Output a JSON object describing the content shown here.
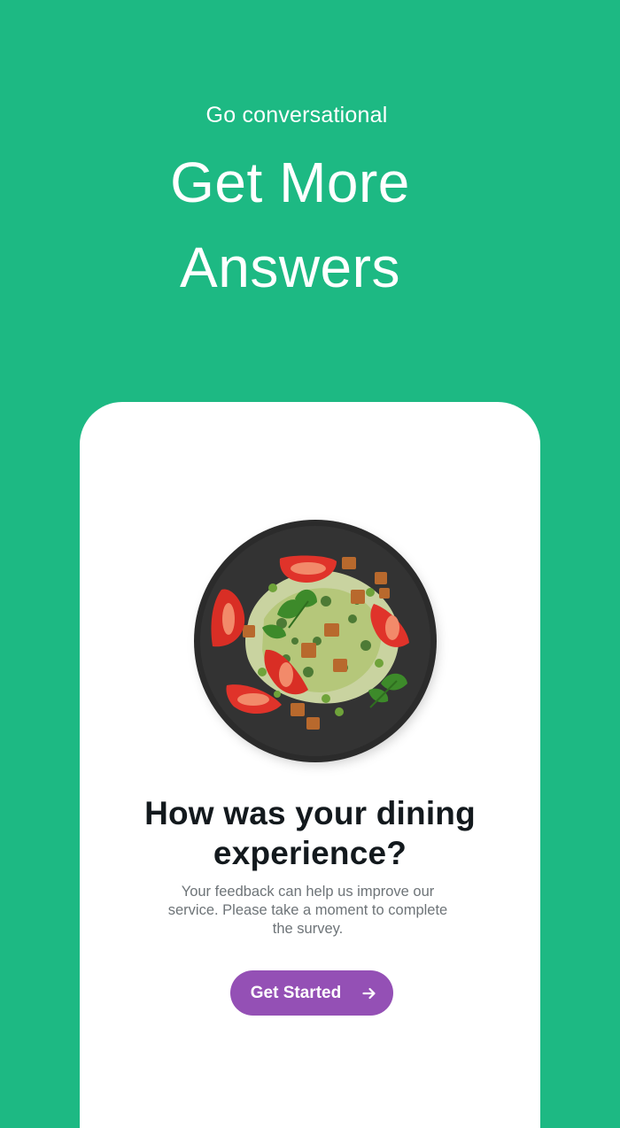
{
  "hero": {
    "eyebrow": "Go conversational",
    "headline_line1": "Get More",
    "headline_line2": "Answers"
  },
  "card": {
    "image": {
      "description": "food-plate-image",
      "icon": "salad-plate"
    },
    "question_line1": "How was your dining",
    "question_line2": "experience?",
    "subtext": "Your feedback can help us improve our service. Please take a moment to complete the survey.",
    "cta": {
      "label": "Get Started",
      "icon": "arrow-right-icon"
    }
  },
  "colors": {
    "background": "#1db983",
    "card": "#ffffff",
    "button": "#9450b5",
    "heading": "#13191d",
    "body_text": "#6e7478"
  }
}
